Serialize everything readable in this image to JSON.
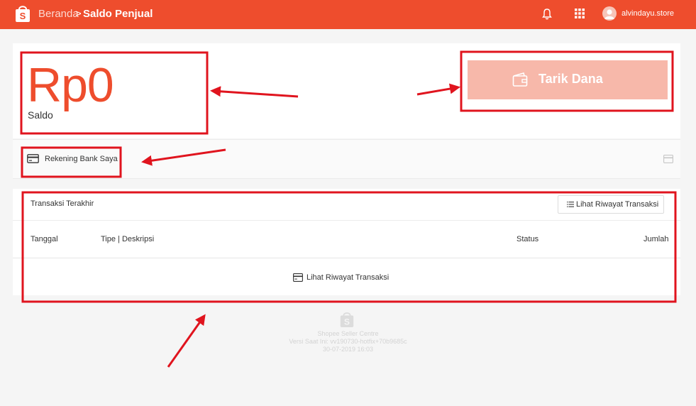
{
  "header": {
    "breadcrumb_home": "Beranda",
    "breadcrumb_separator": ">",
    "breadcrumb_current": "Saldo Penjual",
    "username": "alvindayu.store",
    "icons": [
      "shopee-logo-icon",
      "bell-icon",
      "apps-grid-icon",
      "avatar-icon"
    ]
  },
  "balance": {
    "amount": "Rp0",
    "label": "Saldo",
    "withdraw_label": "Tarik Dana",
    "withdraw_icon": "wallet-icon"
  },
  "bank": {
    "label": "Rekening Bank Saya",
    "icon": "credit-card-icon"
  },
  "transactions": {
    "title": "Transaksi Terakhir",
    "history_button": "Lihat Riwayat Transaksi",
    "columns": [
      "Tanggal",
      "Tipe | Deskripsi",
      "Status",
      "Jumlah"
    ],
    "empty_link": "Lihat Riwayat Transaksi"
  },
  "footer": {
    "line1": "Shopee Seller Centre",
    "line2": "Versi Saat Ini: vv190730-hotfix+70b9685c",
    "line3": "30-07-2019 16:03"
  },
  "colors": {
    "brand": "#ee4d2d",
    "button_disabled": "#f7b8aa",
    "annotation": "#e0141e"
  }
}
